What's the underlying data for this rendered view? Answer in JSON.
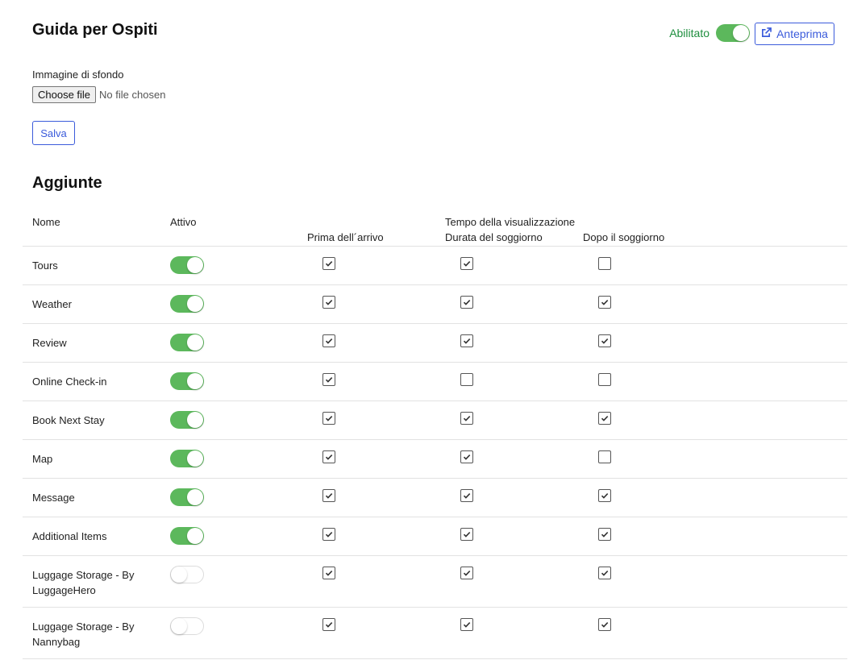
{
  "header": {
    "title": "Guida per Ospiti",
    "enabled_label": "Abilitato",
    "enabled": true,
    "preview_label": "Anteprima"
  },
  "background": {
    "label": "Immagine di sfondo",
    "file_button": "Choose file",
    "file_status": "No file chosen"
  },
  "save_label": "Salva",
  "addons": {
    "title": "Aggiunte",
    "columns": {
      "name": "Nome",
      "active": "Attivo",
      "time_group": "Tempo della visualizzazione",
      "before": "Prima dell´arrivo",
      "during": "Durata del soggiorno",
      "after": "Dopo il soggiorno"
    },
    "rows": [
      {
        "name": "Tours",
        "active": true,
        "before": true,
        "during": true,
        "after": false
      },
      {
        "name": "Weather",
        "active": true,
        "before": true,
        "during": true,
        "after": true
      },
      {
        "name": "Review",
        "active": true,
        "before": true,
        "during": true,
        "after": true
      },
      {
        "name": "Online Check-in",
        "active": true,
        "before": true,
        "during": false,
        "after": false
      },
      {
        "name": "Book Next Stay",
        "active": true,
        "before": true,
        "during": true,
        "after": true
      },
      {
        "name": "Map",
        "active": true,
        "before": true,
        "during": true,
        "after": false
      },
      {
        "name": "Message",
        "active": true,
        "before": true,
        "during": true,
        "after": true
      },
      {
        "name": "Additional Items",
        "active": true,
        "before": true,
        "during": true,
        "after": true
      },
      {
        "name": "Luggage Storage - By LuggageHero",
        "active": false,
        "before": true,
        "during": true,
        "after": true
      },
      {
        "name": "Luggage Storage - By Nannybag",
        "active": false,
        "before": true,
        "during": true,
        "after": true
      }
    ]
  },
  "colors": {
    "accent": "#3b5bdb",
    "toggle_on": "#5cb85c",
    "enabled_text": "#1e8e3e"
  }
}
